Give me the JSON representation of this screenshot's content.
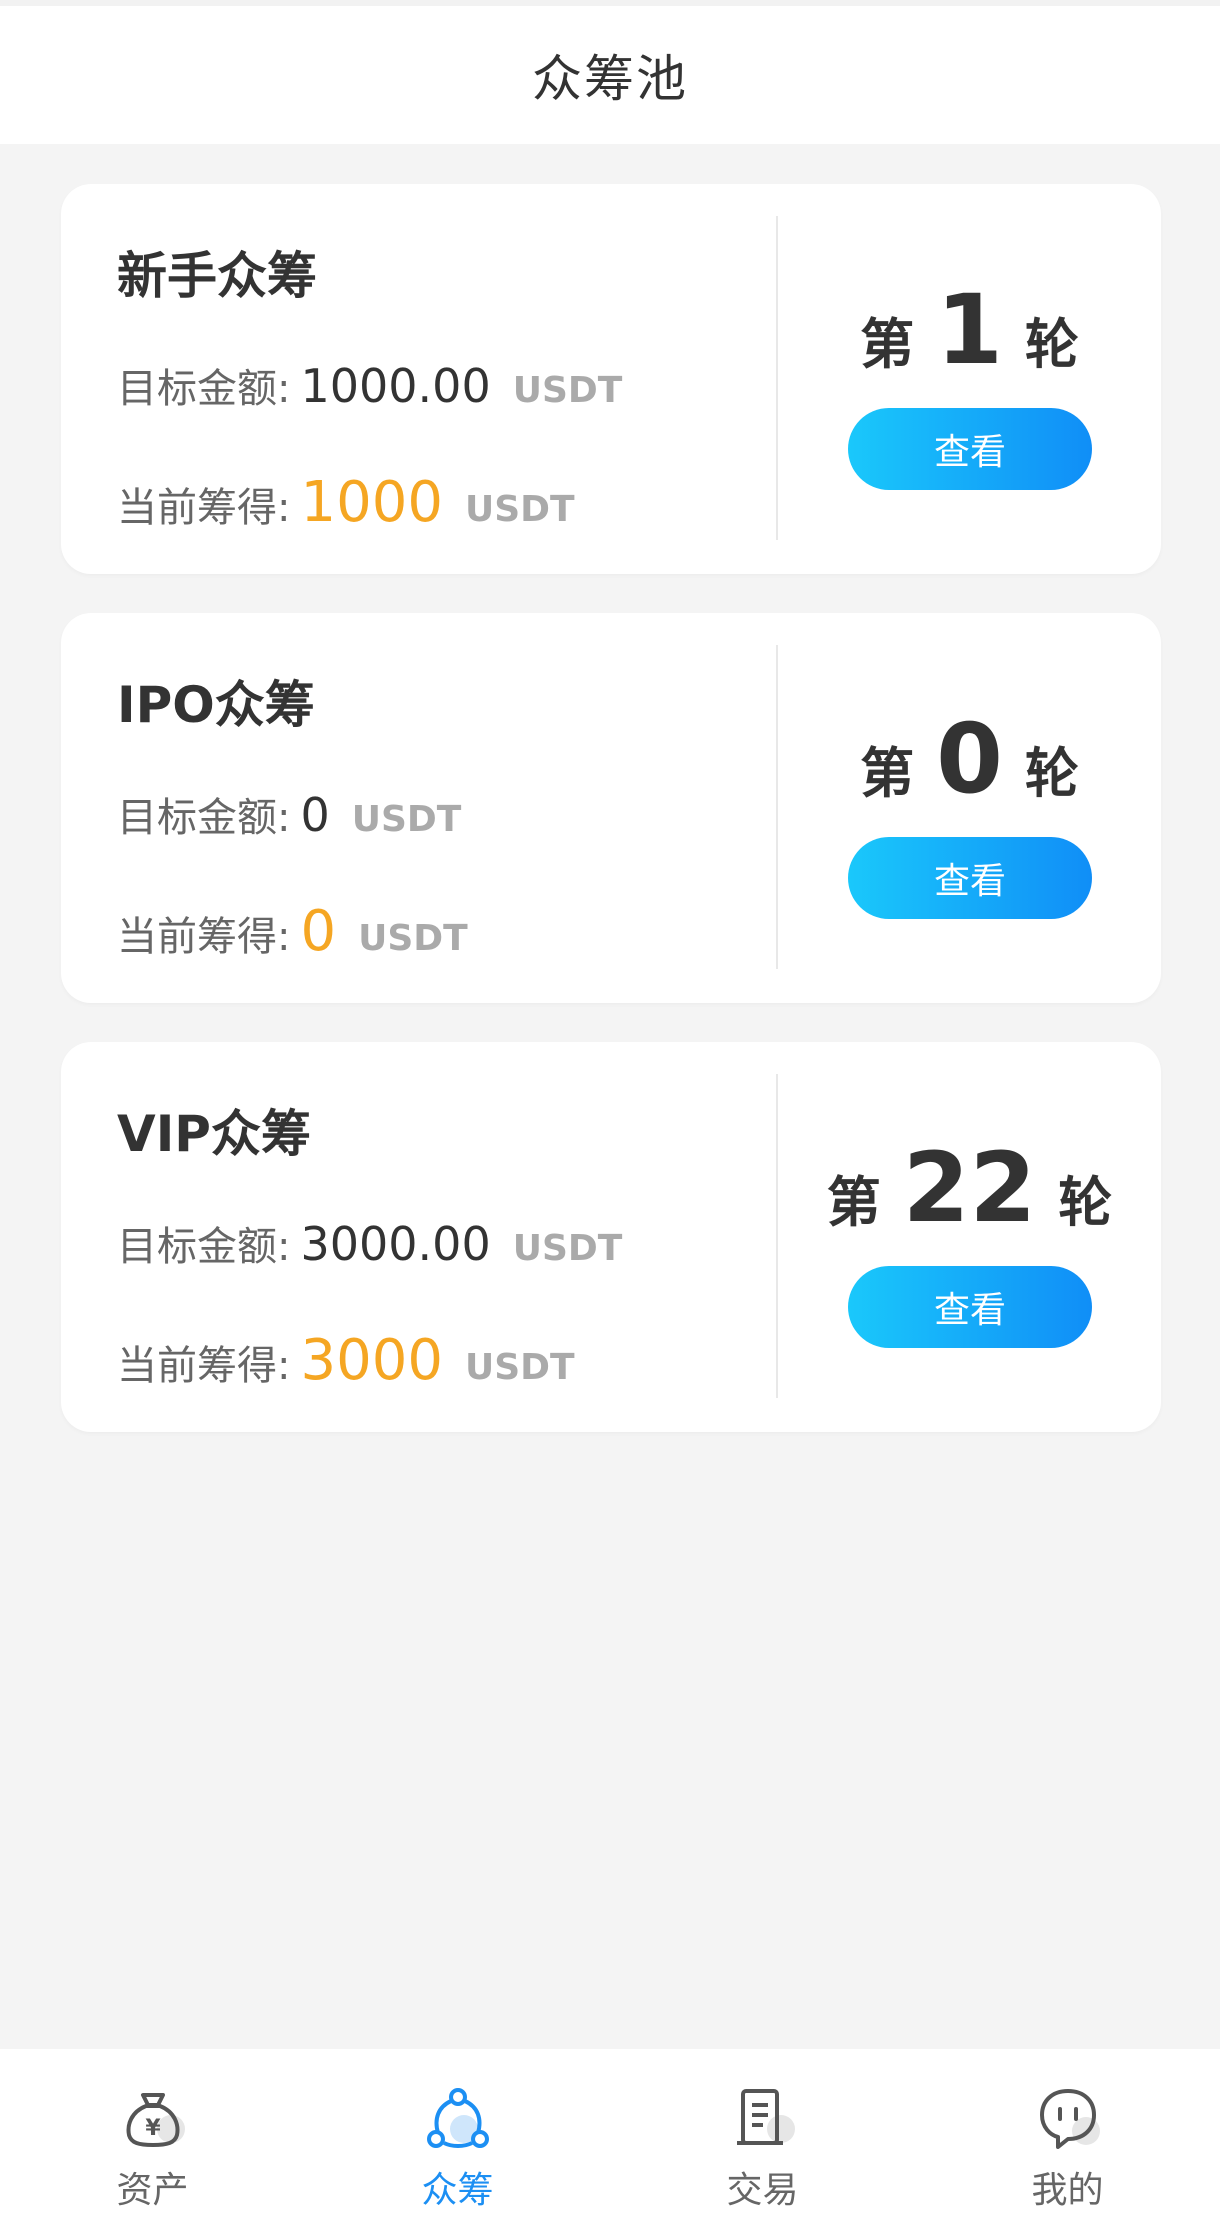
{
  "header": {
    "title": "众筹池"
  },
  "pools": [
    {
      "title": "新手众筹",
      "target_label": "目标金额:",
      "target_value": "1000.00",
      "target_unit": "USDT",
      "raised_label": "当前筹得:",
      "raised_value": "1000",
      "raised_unit": "USDT",
      "round_prefix": "第",
      "round_number": "1",
      "round_suffix": "轮",
      "button_label": "查看"
    },
    {
      "title": "IPO众筹",
      "target_label": "目标金额:",
      "target_value": "0",
      "target_unit": "USDT",
      "raised_label": "当前筹得:",
      "raised_value": "0",
      "raised_unit": "USDT",
      "round_prefix": "第",
      "round_number": "0",
      "round_suffix": "轮",
      "button_label": "查看"
    },
    {
      "title": "VIP众筹",
      "target_label": "目标金额:",
      "target_value": "3000.00",
      "target_unit": "USDT",
      "raised_label": "当前筹得:",
      "raised_value": "3000",
      "raised_unit": "USDT",
      "round_prefix": "第",
      "round_number": "22",
      "round_suffix": "轮",
      "button_label": "查看"
    }
  ],
  "tabbar": {
    "items": [
      {
        "label": "资产",
        "icon": "money-bag-icon",
        "active": false
      },
      {
        "label": "众筹",
        "icon": "crowdfund-nodes-icon",
        "active": true
      },
      {
        "label": "交易",
        "icon": "document-icon",
        "active": false
      },
      {
        "label": "我的",
        "icon": "user-face-icon",
        "active": false
      }
    ]
  },
  "colors": {
    "accent": "#1c8ff3",
    "raised": "#f5a623",
    "button_start": "#1ac8fb",
    "button_end": "#108ef7"
  }
}
